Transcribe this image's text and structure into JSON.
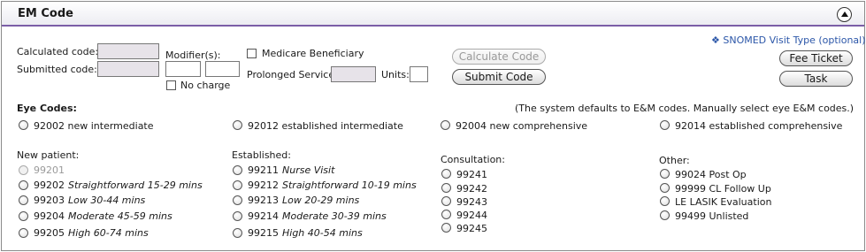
{
  "header": {
    "title": "EM Code"
  },
  "coding": {
    "calculated_label": "Calculated code:",
    "submitted_label": "Submitted code:",
    "modifiers_label": "Modifier(s):",
    "no_charge_label": "No charge",
    "medicare_label": "Medicare Beneficiary",
    "prolonged_label": "Prolonged Service:",
    "units_label": "Units:",
    "calculate_button": "Calculate Code",
    "submit_button": "Submit Code",
    "snomed_link": "SNOMED Visit Type (optional)",
    "snomed_icon": "diamond-icon",
    "fee_ticket_button": "Fee Ticket",
    "task_button": "Task"
  },
  "eye_codes": {
    "label": "Eye Codes:",
    "note": "(The system defaults to E&M codes.  Manually select eye E&M codes.)",
    "options": [
      {
        "code": "92002",
        "desc": "new intermediate"
      },
      {
        "code": "92012",
        "desc": "established intermediate"
      },
      {
        "code": "92004",
        "desc": "new comprehensive"
      },
      {
        "code": "92014",
        "desc": "established comprehensive"
      }
    ]
  },
  "new_patient": {
    "label": "New patient:",
    "items": [
      {
        "code": "99201",
        "desc": "",
        "disabled": true
      },
      {
        "code": "99202",
        "desc": "Straightforward 15-29 mins"
      },
      {
        "code": "99203",
        "desc": "Low 30-44 mins"
      },
      {
        "code": "99204",
        "desc": "Moderate 45-59 mins"
      },
      {
        "code": "99205",
        "desc": "High 60-74 mins"
      }
    ]
  },
  "established": {
    "label": "Established:",
    "items": [
      {
        "code": "99211",
        "desc": "Nurse Visit"
      },
      {
        "code": "99212",
        "desc": "Straightforward 10-19 mins"
      },
      {
        "code": "99213",
        "desc": "Low 20-29 mins"
      },
      {
        "code": "99214",
        "desc": "Moderate 30-39 mins"
      },
      {
        "code": "99215",
        "desc": "High 40-54 mins"
      }
    ]
  },
  "consultation": {
    "label": "Consultation:",
    "items": [
      {
        "code": "99241"
      },
      {
        "code": "99242"
      },
      {
        "code": "99243"
      },
      {
        "code": "99244"
      },
      {
        "code": "99245"
      }
    ]
  },
  "other": {
    "label": "Other:",
    "items": [
      {
        "code": "99024 Post Op"
      },
      {
        "code": "99999 CL Follow Up"
      },
      {
        "code": "LE LASIK Evaluation"
      },
      {
        "code": "99499 Unlisted"
      }
    ]
  }
}
